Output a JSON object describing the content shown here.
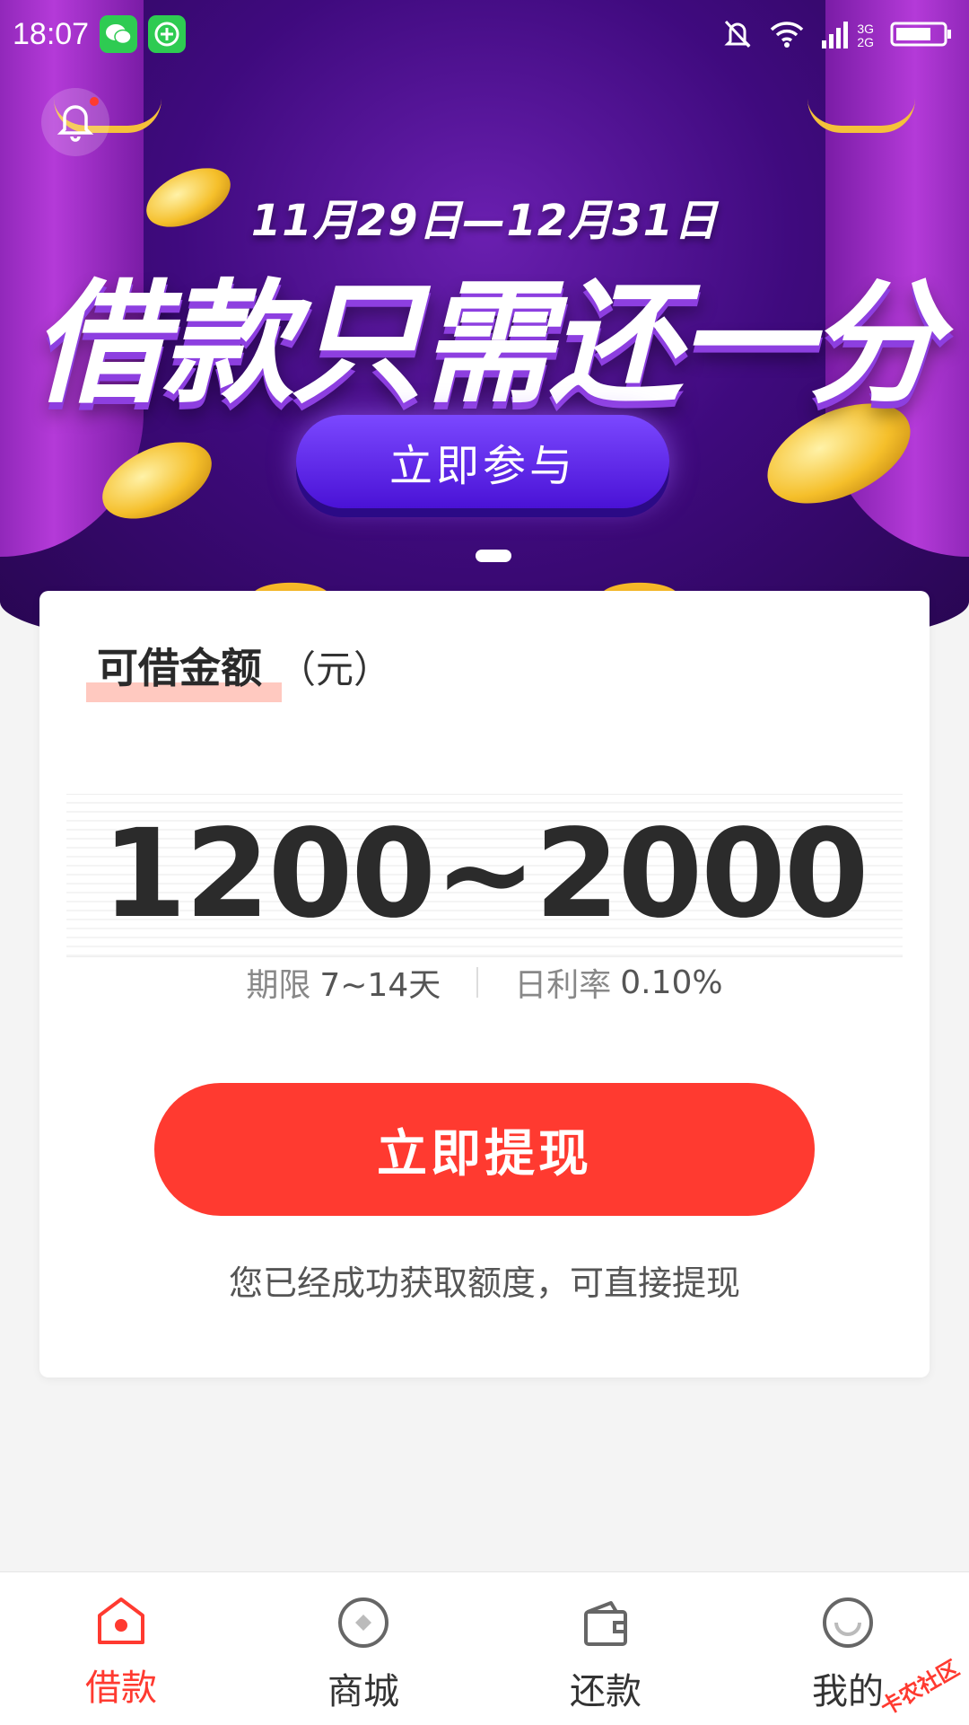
{
  "status_bar": {
    "time": "18:07",
    "net_top": "3G",
    "net_bottom": "2G"
  },
  "banner": {
    "date_range": "11月29日—12月31日",
    "headline": "借款只需还一分",
    "cta_label": "立即参与"
  },
  "loan_card": {
    "title": "可借金额",
    "unit": "（元）",
    "amount_range": "1200~2000",
    "term_label": "期限",
    "term_value": "7~14天",
    "rate_label": "日利率",
    "rate_value": "0.10%",
    "withdraw_label": "立即提现",
    "hint": "您已经成功获取额度，可直接提现"
  },
  "bottom_nav": {
    "items": [
      {
        "label": "借款",
        "icon": "home-icon",
        "active": true
      },
      {
        "label": "商城",
        "icon": "mall-icon",
        "active": false
      },
      {
        "label": "还款",
        "icon": "wallet-icon",
        "active": false
      },
      {
        "label": "我的",
        "icon": "profile-icon",
        "active": false
      }
    ]
  },
  "watermark": "卡农社区",
  "colors": {
    "accent": "#ff3a30",
    "banner_purple": "#3f0a7e",
    "promo_button": "#5a22e6"
  }
}
